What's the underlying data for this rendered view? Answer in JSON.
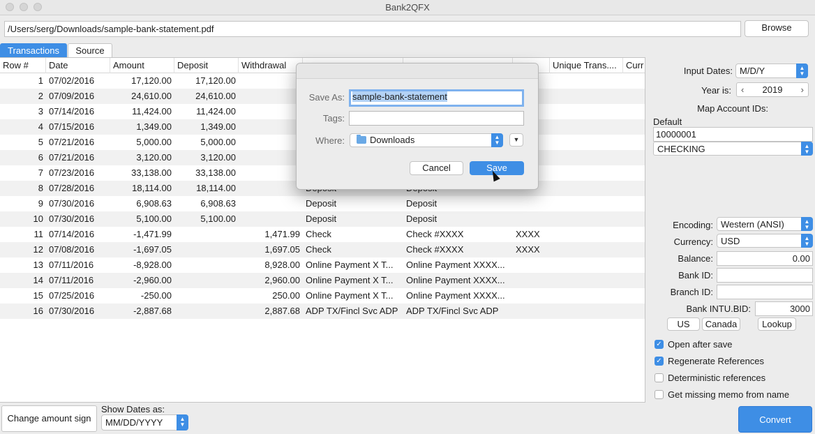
{
  "window": {
    "title": "Bank2QFX"
  },
  "file_path": "/Users/serg/Downloads/sample-bank-statement.pdf",
  "browse_label": "Browse",
  "tabs": [
    {
      "label": "Transactions"
    },
    {
      "label": "Source"
    }
  ],
  "table": {
    "columns": [
      "Row #",
      "Date",
      "Amount",
      "Deposit",
      "Withdrawal",
      "",
      "",
      "",
      "Unique Trans....",
      "Curr"
    ],
    "rows": [
      {
        "n": "1",
        "date": "07/02/2016",
        "amount": "17,120.00",
        "deposit": "17,120.00",
        "withdrawal": "",
        "payee": "",
        "memo": "",
        "chk": ""
      },
      {
        "n": "2",
        "date": "07/09/2016",
        "amount": "24,610.00",
        "deposit": "24,610.00",
        "withdrawal": "",
        "payee": "",
        "memo": "",
        "chk": ""
      },
      {
        "n": "3",
        "date": "07/14/2016",
        "amount": "11,424.00",
        "deposit": "11,424.00",
        "withdrawal": "",
        "payee": "",
        "memo": "",
        "chk": ""
      },
      {
        "n": "4",
        "date": "07/15/2016",
        "amount": "1,349.00",
        "deposit": "1,349.00",
        "withdrawal": "",
        "payee": "",
        "memo": "",
        "chk": ""
      },
      {
        "n": "5",
        "date": "07/21/2016",
        "amount": "5,000.00",
        "deposit": "5,000.00",
        "withdrawal": "",
        "payee": "",
        "memo": "",
        "chk": ""
      },
      {
        "n": "6",
        "date": "07/21/2016",
        "amount": "3,120.00",
        "deposit": "3,120.00",
        "withdrawal": "",
        "payee": "",
        "memo": "",
        "chk": ""
      },
      {
        "n": "7",
        "date": "07/23/2016",
        "amount": "33,138.00",
        "deposit": "33,138.00",
        "withdrawal": "",
        "payee": "",
        "memo": "",
        "chk": ""
      },
      {
        "n": "8",
        "date": "07/28/2016",
        "amount": "18,114.00",
        "deposit": "18,114.00",
        "withdrawal": "",
        "payee": "Deposit",
        "memo": "Deposit",
        "chk": ""
      },
      {
        "n": "9",
        "date": "07/30/2016",
        "amount": "6,908.63",
        "deposit": "6,908.63",
        "withdrawal": "",
        "payee": "Deposit",
        "memo": "Deposit",
        "chk": ""
      },
      {
        "n": "10",
        "date": "07/30/2016",
        "amount": "5,100.00",
        "deposit": "5,100.00",
        "withdrawal": "",
        "payee": "Deposit",
        "memo": "Deposit",
        "chk": ""
      },
      {
        "n": "11",
        "date": "07/14/2016",
        "amount": "-1,471.99",
        "deposit": "",
        "withdrawal": "1,471.99",
        "payee": "Check",
        "memo": "Check #XXXX",
        "chk": "XXXX"
      },
      {
        "n": "12",
        "date": "07/08/2016",
        "amount": "-1,697.05",
        "deposit": "",
        "withdrawal": "1,697.05",
        "payee": "Check",
        "memo": "Check #XXXX",
        "chk": "XXXX"
      },
      {
        "n": "13",
        "date": "07/11/2016",
        "amount": "-8,928.00",
        "deposit": "",
        "withdrawal": "8,928.00",
        "payee": "Online Payment X T...",
        "memo": "Online Payment XXXX...",
        "chk": ""
      },
      {
        "n": "14",
        "date": "07/11/2016",
        "amount": "-2,960.00",
        "deposit": "",
        "withdrawal": "2,960.00",
        "payee": "Online Payment X T...",
        "memo": "Online Payment XXXX...",
        "chk": ""
      },
      {
        "n": "15",
        "date": "07/25/2016",
        "amount": "-250.00",
        "deposit": "",
        "withdrawal": "250.00",
        "payee": "Online Payment X T...",
        "memo": "Online Payment XXXX...",
        "chk": ""
      },
      {
        "n": "16",
        "date": "07/30/2016",
        "amount": "-2,887.68",
        "deposit": "",
        "withdrawal": "2,887.68",
        "payee": "ADP TX/Fincl Svc ADP",
        "memo": "ADP TX/Fincl Svc ADP",
        "chk": ""
      }
    ]
  },
  "bottom": {
    "change_sign_label": "Change amount sign",
    "show_dates_label": "Show Dates as:",
    "show_dates_value": "MM/DD/YYYY"
  },
  "settings": {
    "input_dates_label": "Input Dates:",
    "input_dates_value": "M/D/Y",
    "year_label": "Year is:",
    "year_value": "2019",
    "map_label": "Map Account IDs:",
    "default_label": "Default",
    "account_id": "10000001",
    "account_type": "CHECKING",
    "encoding_label": "Encoding:",
    "encoding_value": "Western (ANSI)",
    "currency_label": "Currency:",
    "currency_value": "USD",
    "balance_label": "Balance:",
    "balance_value": "0.00",
    "bank_id_label": "Bank ID:",
    "bank_id_value": "",
    "branch_id_label": "Branch ID:",
    "branch_id_value": "",
    "intu_label": "Bank INTU.BID:",
    "intu_value": "3000",
    "us_label": "US",
    "canada_label": "Canada",
    "lookup_label": "Lookup",
    "checks": [
      {
        "label": "Open after save",
        "checked": true
      },
      {
        "label": "Regenerate References",
        "checked": true
      },
      {
        "label": "Deterministic references",
        "checked": false
      },
      {
        "label": "Get missing memo from name",
        "checked": false
      }
    ],
    "convert_label": "Convert"
  },
  "dialog": {
    "save_as_label": "Save As:",
    "save_as_value": "sample-bank-statement",
    "tags_label": "Tags:",
    "where_label": "Where:",
    "where_value": "Downloads",
    "cancel_label": "Cancel",
    "save_label": "Save"
  },
  "colors": {
    "accent": "#3e8ee5"
  }
}
